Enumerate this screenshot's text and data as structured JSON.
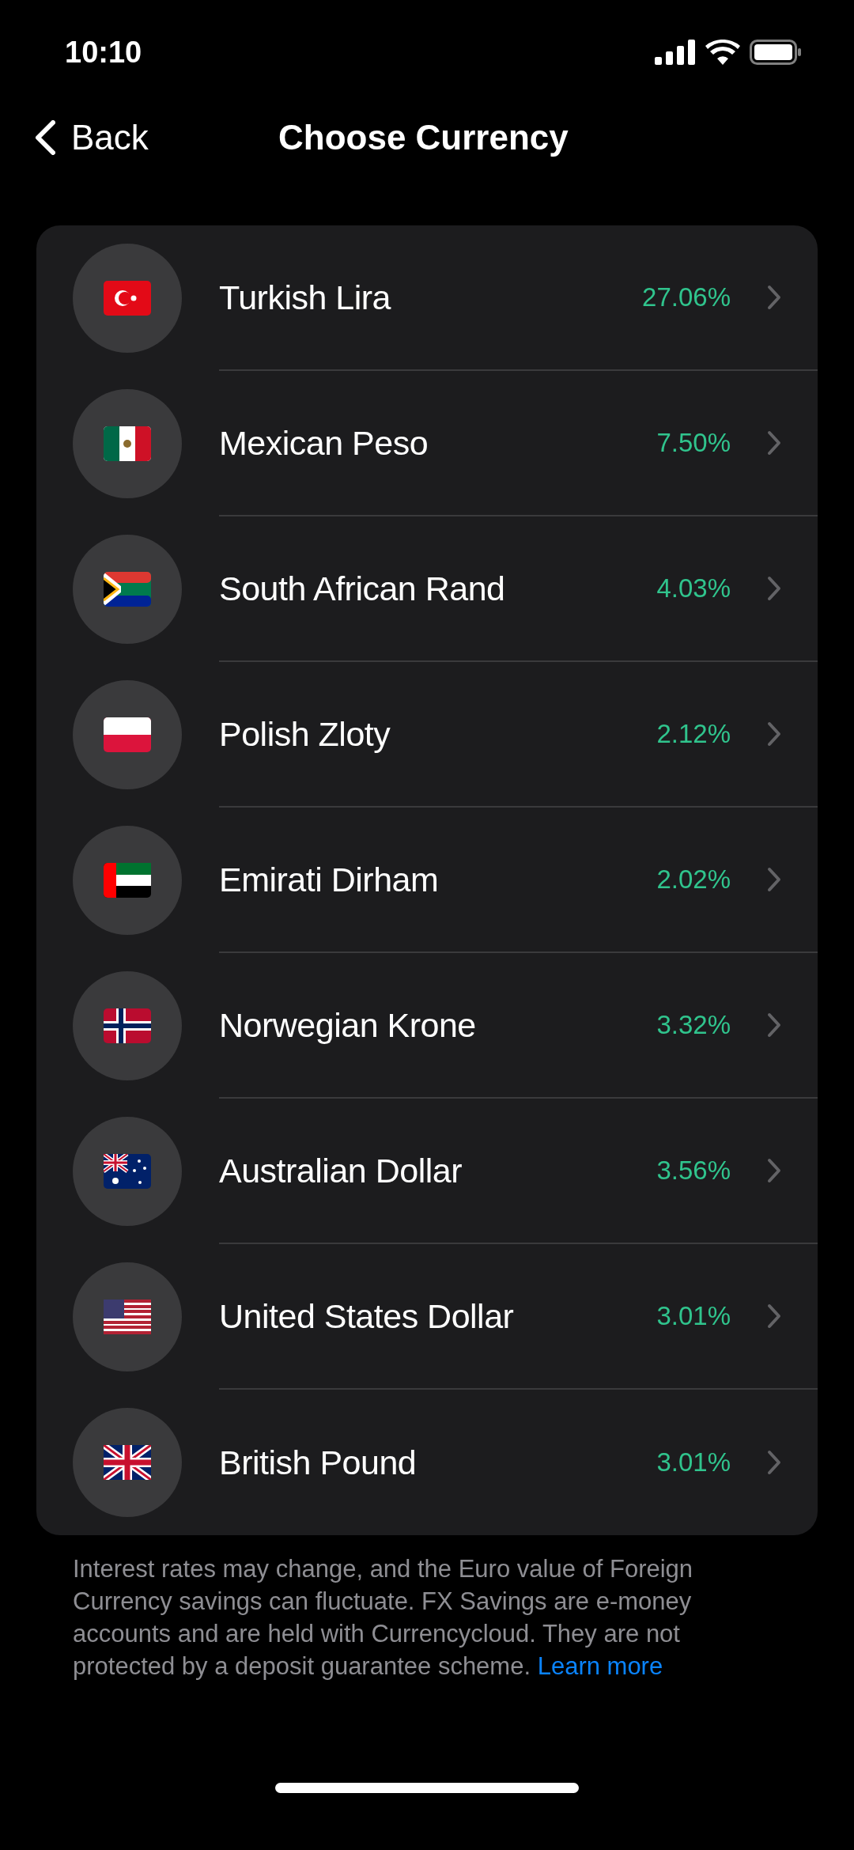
{
  "status_bar": {
    "time": "10:10"
  },
  "nav": {
    "back": "Back",
    "title": "Choose Currency"
  },
  "currencies": [
    {
      "name": "Turkish Lira",
      "rate": "27.06%"
    },
    {
      "name": "Mexican Peso",
      "rate": "7.50%"
    },
    {
      "name": "South African Rand",
      "rate": "4.03%"
    },
    {
      "name": "Polish Zloty",
      "rate": "2.12%"
    },
    {
      "name": "Emirati Dirham",
      "rate": "2.02%"
    },
    {
      "name": "Norwegian Krone",
      "rate": "3.32%"
    },
    {
      "name": "Australian Dollar",
      "rate": "3.56%"
    },
    {
      "name": "United States Dollar",
      "rate": "3.01%"
    },
    {
      "name": "British Pound",
      "rate": "3.01%"
    }
  ],
  "footer": {
    "text": "Interest rates may change, and the Euro value of Foreign Currency savings can fluctuate. FX Savings are e-money accounts and are held with Currencycloud. They are not protected by a deposit guarantee scheme.",
    "link": "Learn more"
  }
}
